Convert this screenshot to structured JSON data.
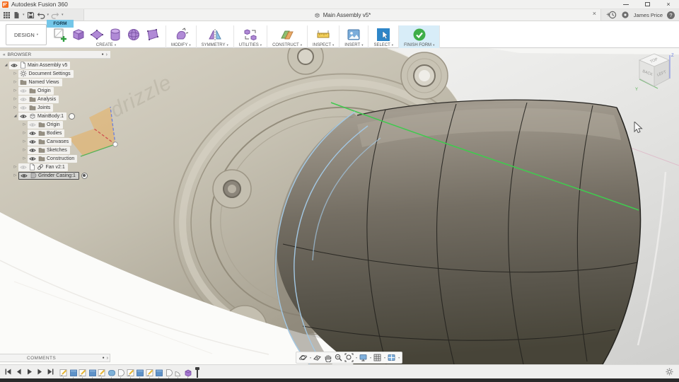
{
  "titlebar": {
    "app_title": "Autodesk Fusion 360"
  },
  "window_controls": {
    "close_glyph": "×"
  },
  "tabbar": {
    "document_tab": {
      "title": "Main Assembly v5*",
      "close_glyph": "×"
    },
    "new_tab_glyph": "+",
    "user_name": "James Price",
    "help_glyph": "?"
  },
  "toolbar": {
    "workspace_button": "DESIGN",
    "context_tab": "FORM",
    "caret_glyph": "▾",
    "groups": [
      {
        "label": "CREATE",
        "icons": [
          "create-form-box-icon",
          "box-icon",
          "plane-icon",
          "cylinder-icon",
          "sphere-icon",
          "face-icon"
        ]
      },
      {
        "label": "MODIFY",
        "icons": [
          "edit-form-icon"
        ]
      },
      {
        "label": "SYMMETRY",
        "icons": [
          "mirror-icon"
        ]
      },
      {
        "label": "UTILITIES",
        "icons": [
          "convert-icon"
        ]
      },
      {
        "label": "CONSTRUCT",
        "icons": [
          "construct-plane-icon"
        ]
      },
      {
        "label": "INSPECT",
        "icons": [
          "measure-icon"
        ]
      },
      {
        "label": "INSERT",
        "icons": [
          "insert-image-icon"
        ]
      },
      {
        "label": "SELECT",
        "icons": [
          "select-icon"
        ]
      },
      {
        "label": "FINISH FORM",
        "icons": [
          "finish-form-icon"
        ],
        "highlighted": true
      }
    ]
  },
  "browser": {
    "header": "BROWSER",
    "items": [
      {
        "label": "Main Assembly v5",
        "depth": 0,
        "arrow": "expanded",
        "eye": "on",
        "icon": "doc-icon"
      },
      {
        "label": "Document Settings",
        "depth": 1,
        "arrow": "collapsed",
        "eye": "none",
        "icon": "gear-icon"
      },
      {
        "label": "Named Views",
        "depth": 1,
        "arrow": "collapsed",
        "eye": "none",
        "icon": "folder-icon"
      },
      {
        "label": "Origin",
        "depth": 1,
        "arrow": "collapsed",
        "eye": "dim",
        "icon": "folder-icon"
      },
      {
        "label": "Analysis",
        "depth": 1,
        "arrow": "collapsed",
        "eye": "dim",
        "icon": "folder-icon"
      },
      {
        "label": "Joints",
        "depth": 1,
        "arrow": "collapsed",
        "eye": "dim",
        "icon": "folder-icon"
      },
      {
        "label": "MainBody:1",
        "depth": 1,
        "arrow": "expanded",
        "eye": "on",
        "icon": "component-icon",
        "radio": "empty"
      },
      {
        "label": "Origin",
        "depth": 2,
        "arrow": "collapsed",
        "eye": "dim",
        "icon": "folder-icon"
      },
      {
        "label": "Bodies",
        "depth": 2,
        "arrow": "collapsed",
        "eye": "on",
        "icon": "folder-icon"
      },
      {
        "label": "Canvases",
        "depth": 2,
        "arrow": "collapsed",
        "eye": "on",
        "icon": "folder-icon"
      },
      {
        "label": "Sketches",
        "depth": 2,
        "arrow": "collapsed",
        "eye": "on",
        "icon": "folder-icon"
      },
      {
        "label": "Construction",
        "depth": 2,
        "arrow": "collapsed",
        "eye": "on",
        "icon": "folder-icon"
      },
      {
        "label": "Fan v2:1",
        "depth": 1,
        "arrow": "collapsed",
        "eye": "dim",
        "icon": "doc-icon",
        "link": true
      },
      {
        "label": "Grinder Casing:1",
        "depth": 1,
        "arrow": "collapsed",
        "eye": "on",
        "icon": "body-icon",
        "selected": true,
        "radio": "dot"
      }
    ]
  },
  "viewport": {
    "viewcube": {
      "top": "TOP",
      "left": "BACK",
      "right": "LEFT",
      "z": "Z",
      "y": "Y"
    },
    "embossed_text": "drizzle"
  },
  "comments": {
    "label": "COMMENTS"
  },
  "navbar": {
    "items": [
      {
        "icon": "orbit-icon",
        "caret": true
      },
      {
        "icon": "look-at-icon",
        "caret": false
      },
      {
        "icon": "pan-icon",
        "caret": false
      },
      {
        "icon": "zoom-icon",
        "caret": false
      },
      {
        "icon": "fit-icon",
        "caret": true
      },
      {
        "icon": "display-settings-icon",
        "caret": true
      },
      {
        "icon": "grid-snaps-icon",
        "caret": true
      },
      {
        "icon": "viewports-icon",
        "caret": true
      }
    ]
  },
  "playback": {
    "items": [
      "go-to-start-icon",
      "step-back-icon",
      "play-icon",
      "step-forward-icon",
      "go-to-end-icon"
    ]
  },
  "timeline": {
    "items": [
      {
        "type": "sketch"
      },
      {
        "type": "feature"
      },
      {
        "type": "sketch"
      },
      {
        "type": "feature"
      },
      {
        "type": "sketch"
      },
      {
        "type": "feature-round"
      },
      {
        "type": "body"
      },
      {
        "type": "sketch"
      },
      {
        "type": "feature"
      },
      {
        "type": "sketch"
      },
      {
        "type": "feature"
      },
      {
        "type": "body"
      },
      {
        "type": "body-wedge"
      },
      {
        "type": "form"
      }
    ]
  },
  "glyphs": {
    "expanded": "◢",
    "collapsed": "▷",
    "panel_collapse": "«",
    "panel_chevron": "›",
    "dot": "●"
  },
  "colors": {
    "context_tab_blue": "#74c6e8",
    "finish_form_green": "#3fae49",
    "form_purple": "#b08ad6",
    "select_blue": "#2e86c8",
    "highlight_edge_green": "#41c94f",
    "tspline_edge_blue": "#a3c8e4"
  }
}
